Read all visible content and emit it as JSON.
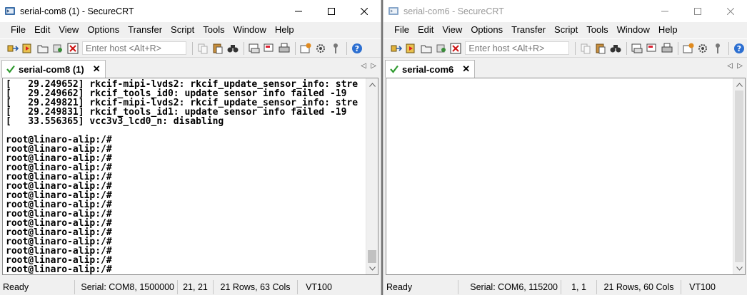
{
  "windows": [
    {
      "title": "serial-com8 (1) - SecureCRT",
      "active": true,
      "menu": [
        "File",
        "Edit",
        "View",
        "Options",
        "Transfer",
        "Script",
        "Tools",
        "Window",
        "Help"
      ],
      "host_placeholder": "Enter host <Alt+R>",
      "tab_label": "serial-com8 (1)",
      "terminal_lines": [
        "[   29.249652] rkcif-mipi-lvds2: rkcif_update_sensor_info: stre",
        "[   29.249662] rkcif_tools_id0: update sensor info failed -19",
        "[   29.249821] rkcif-mipi-lvds2: rkcif_update_sensor_info: stre",
        "[   29.249831] rkcif_tools_id1: update sensor info failed -19",
        "[   33.556365] vcc3v3_lcd0_n: disabling",
        "",
        "root@linaro-alip:/#",
        "root@linaro-alip:/#",
        "root@linaro-alip:/#",
        "root@linaro-alip:/#",
        "root@linaro-alip:/#",
        "root@linaro-alip:/#",
        "root@linaro-alip:/#",
        "root@linaro-alip:/#",
        "root@linaro-alip:/#",
        "root@linaro-alip:/#",
        "root@linaro-alip:/#",
        "root@linaro-alip:/#",
        "root@linaro-alip:/#",
        "root@linaro-alip:/#",
        "root@linaro-alip:/#"
      ],
      "status": {
        "ready": "Ready",
        "connection": "Serial: COM8, 1500000",
        "cursor": "21,  21",
        "size": "21 Rows, 63 Cols",
        "emulation": "VT100"
      }
    },
    {
      "title": "serial-com6 - SecureCRT",
      "active": false,
      "menu": [
        "File",
        "Edit",
        "View",
        "Options",
        "Transfer",
        "Script",
        "Tools",
        "Window",
        "Help"
      ],
      "host_placeholder": "Enter host <Alt+R>",
      "tab_label": "serial-com6",
      "terminal_lines": [],
      "status": {
        "ready": "Ready",
        "connection": "Serial: COM6, 115200",
        "cursor": "1,   1",
        "size": "21 Rows, 60 Cols",
        "emulation": "VT100"
      }
    }
  ],
  "colors": {
    "chrome": "#f0f0f0",
    "terminal_bg": "#ffffff",
    "tab_check": "#2e9a2e",
    "inactive_title": "#999999"
  },
  "icons": {
    "app": "securecrt-icon",
    "minimize": "minimize-icon",
    "maximize": "maximize-icon",
    "close": "close-icon",
    "tab_status": "connected-check-icon"
  }
}
